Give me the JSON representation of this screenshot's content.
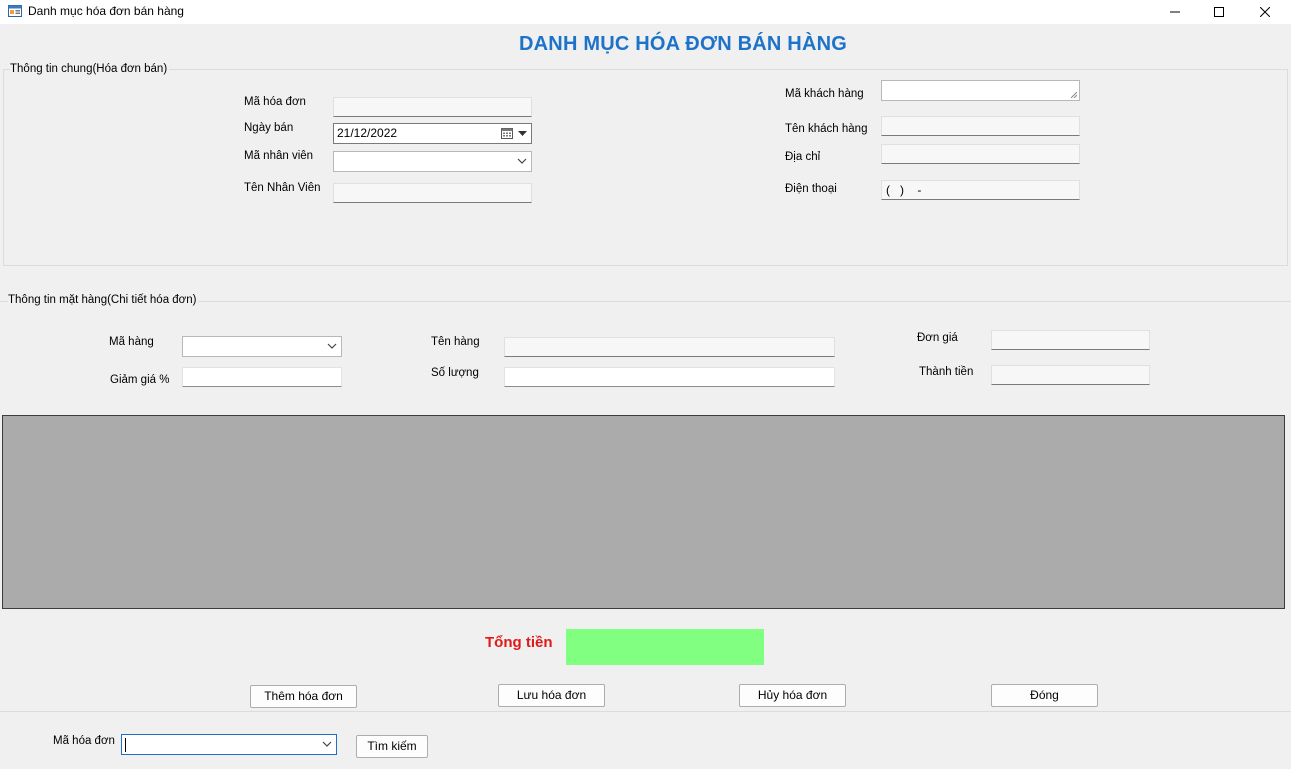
{
  "window": {
    "title": "Danh mục hóa đơn bán hàng",
    "app_icon": "form-app-icon",
    "controls": [
      "minimize-icon",
      "maximize-icon",
      "close-icon"
    ]
  },
  "form_title": "DANH MỤC HÓA ĐƠN BÁN HÀNG",
  "general_info": {
    "legend": "Thông tin chung(Hóa đơn bán)",
    "invoice_code_label": "Mã hóa đơn",
    "invoice_code_value": "",
    "sale_date_label": "Ngày bán",
    "sale_date_value": "21/12/2022",
    "employee_code_label": "Mã nhân viên",
    "employee_code_value": "",
    "employee_name_label": "Tên Nhân Viên",
    "employee_name_value": "",
    "customer_code_label": "Mã khách hàng",
    "customer_code_value": "",
    "customer_name_label": "Tên khách hàng",
    "customer_name_value": "",
    "address_label": "Địa chỉ",
    "address_value": "",
    "phone_label": "Điện thoại",
    "phone_value": "(   )    -"
  },
  "item_info": {
    "legend": "Thông tin mặt hàng(Chi tiết hóa đơn)",
    "item_code_label": "Mã hàng",
    "item_code_value": "",
    "item_name_label": "Tên hàng",
    "item_name_value": "",
    "unit_price_label": "Đơn giá",
    "unit_price_value": "",
    "discount_label": "Giảm giá %",
    "discount_value": "",
    "quantity_label": "Số lượng",
    "quantity_value": "",
    "amount_label": "Thành tiền",
    "amount_value": ""
  },
  "details_grid": {
    "background_color": "#ababab",
    "rows": []
  },
  "total": {
    "label": "Tổng tiền",
    "value": "",
    "label_color": "#e01919",
    "box_color": "#80ff80"
  },
  "buttons": {
    "add_invoice": "Thêm hóa đơn",
    "save_invoice": "Lưu hóa đơn",
    "cancel_invoice": "Hủy hóa đơn",
    "close": "Đóng"
  },
  "search": {
    "label": "Mã hóa đơn",
    "value": "",
    "button": "Tìm kiếm"
  },
  "colors": {
    "title_blue": "#1c73c9",
    "focus_blue": "#1f6fc2"
  }
}
